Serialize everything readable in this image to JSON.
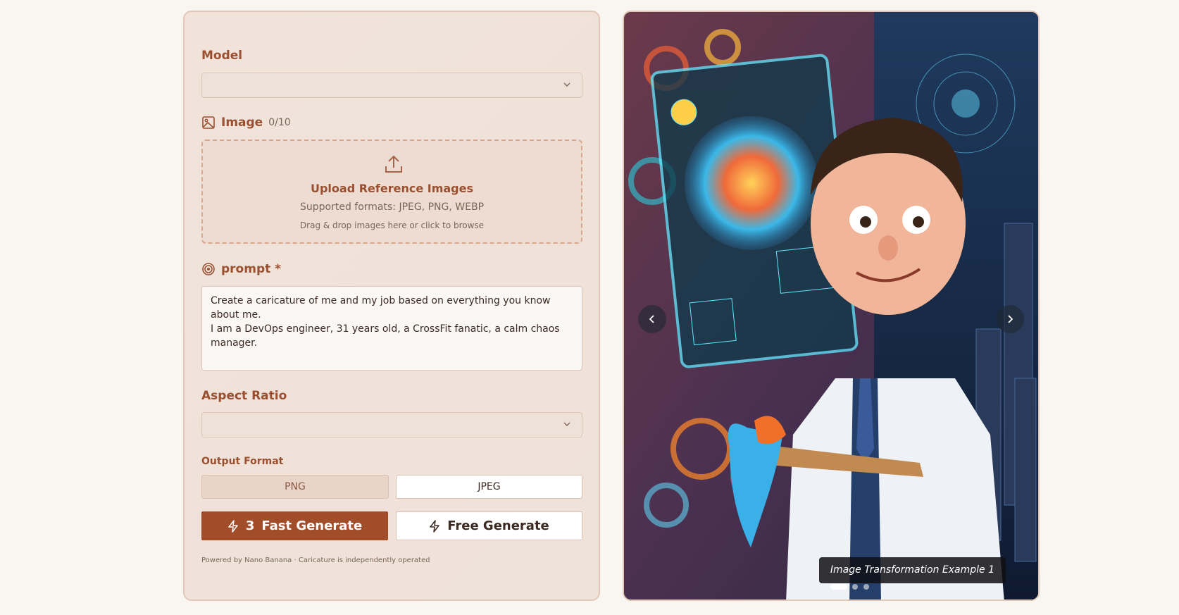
{
  "form": {
    "model_label": "Model",
    "model_value": "",
    "image_label": "Image",
    "image_count": "0/10",
    "upload": {
      "title": "Upload Reference Images",
      "formats": "Supported formats: JPEG, PNG, WEBP",
      "hint": "Drag & drop images here or click to browse"
    },
    "prompt_label": "prompt *",
    "prompt_value": "Create a caricature of me and my job based on everything you know about me.\nI am a DevOps engineer, 31 years old, a CrossFit fanatic, a calm chaos manager.",
    "aspect_label": "Aspect Ratio",
    "aspect_value": "",
    "output_label": "Output Format",
    "format_png": "PNG",
    "format_jpeg": "JPEG",
    "fast_count": "3",
    "fast_label": "Fast Generate",
    "free_label": "Free Generate",
    "footer": "Powered by Nano Banana · Caricature is independently operated"
  },
  "preview": {
    "caption": "Image Transformation Example 1",
    "slide_count": 3,
    "active_slide": 1
  },
  "colors": {
    "accent": "#9a4f31",
    "button_primary": "#a24d2a",
    "panel_bg": "#f1e3d9",
    "page_bg": "#f9f5f0"
  }
}
